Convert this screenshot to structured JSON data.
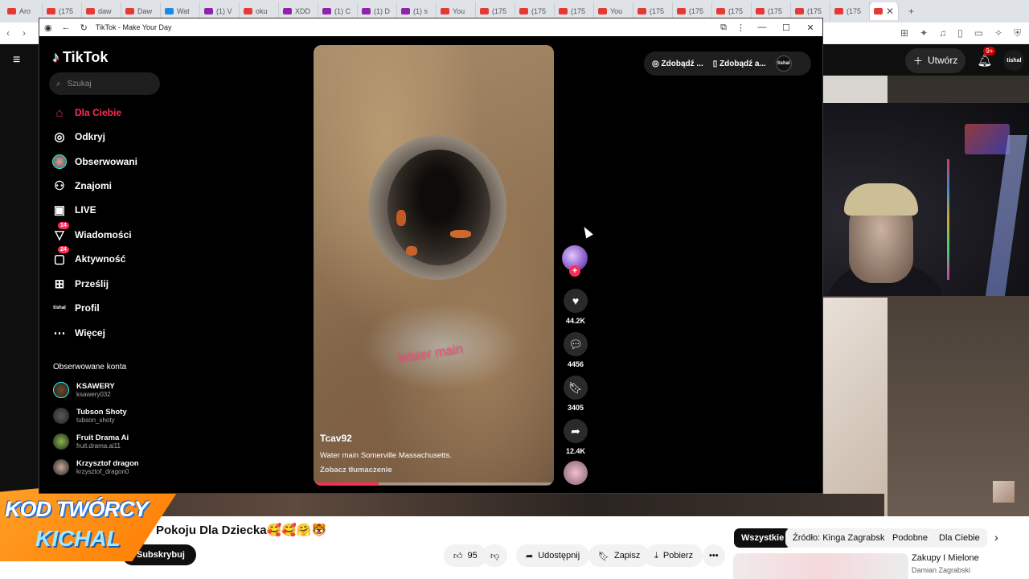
{
  "browser": {
    "tabs": [
      {
        "label": "Aro",
        "color": "#e53935"
      },
      {
        "label": "(175",
        "color": "#e53935"
      },
      {
        "label": "daw",
        "color": "#e53935"
      },
      {
        "label": "Daw",
        "color": "#e53935"
      },
      {
        "label": "Wat",
        "color": "#1e88e5"
      },
      {
        "label": "(1) V",
        "color": "#8e24aa"
      },
      {
        "label": "oku",
        "color": "#e53935"
      },
      {
        "label": "XDD",
        "color": "#8e24aa"
      },
      {
        "label": "(1) C",
        "color": "#8e24aa"
      },
      {
        "label": "(1) D",
        "color": "#8e24aa"
      },
      {
        "label": "(1) s",
        "color": "#8e24aa"
      },
      {
        "label": "You",
        "color": "#e53935"
      },
      {
        "label": "(175",
        "color": "#e53935"
      },
      {
        "label": "(175",
        "color": "#e53935"
      },
      {
        "label": "(175",
        "color": "#e53935"
      },
      {
        "label": "You",
        "color": "#e53935"
      },
      {
        "label": "(175",
        "color": "#e53935"
      },
      {
        "label": "(175",
        "color": "#e53935"
      },
      {
        "label": "(175",
        "color": "#e53935"
      },
      {
        "label": "(175",
        "color": "#e53935"
      },
      {
        "label": "(175",
        "color": "#e53935"
      },
      {
        "label": "(175",
        "color": "#e53935"
      }
    ]
  },
  "popup": {
    "title": "TikTok - Make Your Day"
  },
  "tiktok": {
    "logo": "TikTok",
    "search_placeholder": "Szukaj",
    "nav": [
      {
        "label": "Dla Ciebie",
        "icon": "home-icon",
        "badge": ""
      },
      {
        "label": "Odkryj",
        "icon": "compass-icon",
        "badge": ""
      },
      {
        "label": "Obserwowani",
        "icon": "followed-avatar-icon",
        "badge": ""
      },
      {
        "label": "Znajomi",
        "icon": "friends-icon",
        "badge": ""
      },
      {
        "label": "LIVE",
        "icon": "live-icon",
        "badge": ""
      },
      {
        "label": "Wiadomości",
        "icon": "messages-icon",
        "badge": "14"
      },
      {
        "label": "Aktywność",
        "icon": "activity-icon",
        "badge": "24"
      },
      {
        "label": "Prześlij",
        "icon": "upload-icon",
        "badge": ""
      },
      {
        "label": "Profil",
        "icon": "profile-icon",
        "badge": ""
      },
      {
        "label": "Więcej",
        "icon": "more-icon",
        "badge": ""
      }
    ],
    "profile_icon_text": "tishal",
    "followed_title": "Obserwowane konta",
    "followed_accounts": [
      {
        "name": "KSAWERY",
        "handle": "ksawery032",
        "color": "#6a4a2a"
      },
      {
        "name": "Tubson Shoty",
        "handle": "tubson_shoty",
        "color": "#5a5a5a"
      },
      {
        "name": "Fruit Drama Ai",
        "handle": "fruit.drama.ai11",
        "color": "#8ab845"
      },
      {
        "name": "Krzysztof dragon",
        "handle": "krzysztof_dragon0",
        "color": "#c8a898"
      }
    ],
    "top_buttons": {
      "get_coins": "Zdobądź ...",
      "get_app": "Zdobądź a...",
      "avatar_text": "tishal"
    },
    "video": {
      "author": "Tcav92",
      "description": "Water main Somerville Massachusetts.",
      "translate": "Zobacz tłumaczenie",
      "overlay_text": "Water main",
      "progress": 0.27
    },
    "actions": {
      "likes": "44.2K",
      "comments": "4456",
      "saves": "3405",
      "shares": "12.4K"
    }
  },
  "youtube": {
    "create_label": "Utwórz",
    "notif_badge": "9+",
    "avatar_text": "tishal",
    "title": "Pokoju Dla Dziecka🥰🥰🤗🐯",
    "subscribe": "Subskrybuj",
    "likes": "95",
    "share": "Udostępnij",
    "save": "Zapisz",
    "download": "Pobierz",
    "chips": [
      "Wszystkie",
      "Źródło: Kinga Zagrabska",
      "Podobne",
      "Dla Ciebie"
    ],
    "recommended": {
      "title": "Zakupy I Mielone",
      "channel": "Damian Zagrabski"
    }
  },
  "overlay": {
    "line1": "KOD TWÓRCY",
    "line2": "KICHAL"
  }
}
